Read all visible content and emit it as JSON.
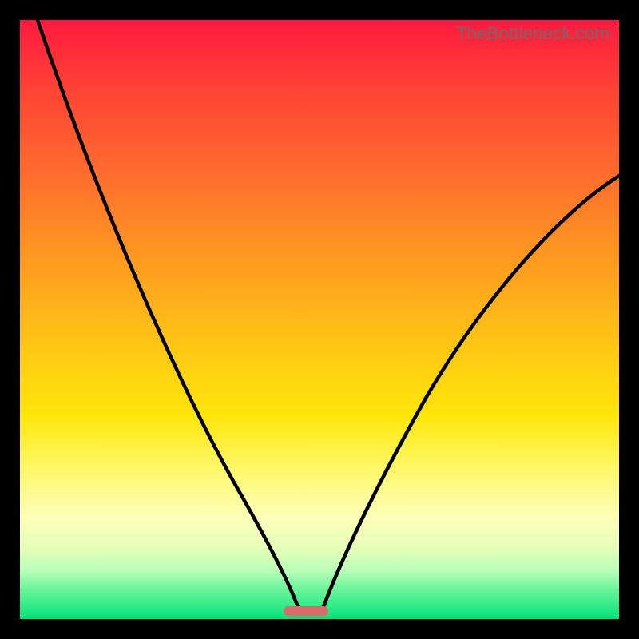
{
  "watermark": "TheBottleneck.com",
  "colors": {
    "frame_bg_top": "#ff1a40",
    "frame_bg_bottom": "#00e478",
    "curve": "#000000",
    "marker": "#d96b6b",
    "page_bg": "#000000",
    "watermark": "#6c6c6c"
  },
  "marker": {
    "x_fraction_start": 0.44,
    "x_fraction_end": 0.515,
    "y_fraction": 0.985
  },
  "chart_data": {
    "type": "line",
    "title": "",
    "xlabel": "",
    "ylabel": "",
    "xlim": [
      0,
      100
    ],
    "ylim": [
      0,
      100
    ],
    "grid": false,
    "note": "No axes or tick labels are rendered. The x-axis is an implicit component-balance axis; the y-axis is an implicit bottleneck-percentage axis. Values are estimated from the curve geometry at the chart's implied precision.",
    "series": [
      {
        "name": "left-curve",
        "x": [
          3,
          10,
          17,
          24,
          30,
          35,
          39,
          42,
          44.5,
          46,
          47
        ],
        "y": [
          100,
          83,
          66,
          50,
          37,
          26,
          17,
          10,
          5,
          2,
          0
        ]
      },
      {
        "name": "right-curve",
        "x": [
          50,
          52,
          55,
          59,
          64,
          70,
          77,
          85,
          93,
          100
        ],
        "y": [
          0,
          3,
          8,
          15,
          24,
          34,
          45,
          56,
          66,
          74
        ]
      }
    ],
    "optimal_range_x": [
      44,
      51.5
    ]
  }
}
